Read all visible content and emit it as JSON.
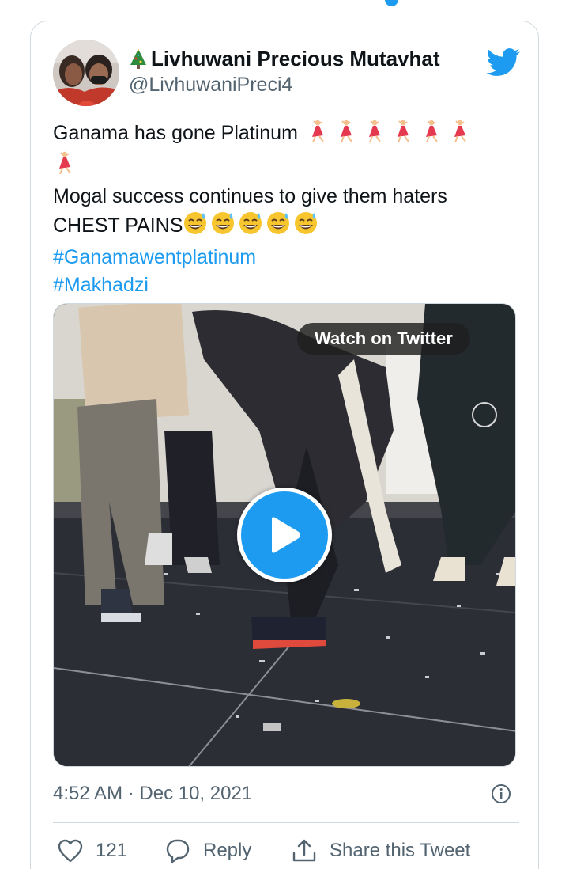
{
  "tweet": {
    "author": {
      "display_name": "Livhuwani Precious Mutavhat",
      "name_prefix_emoji": "🎄",
      "handle": "@LivhuwaniPreci4"
    },
    "text_lines": [
      "Ganama has gone Platinum 💃💃💃💃💃💃",
      "💃",
      "Mogal success continues to give them haters",
      "CHEST PAINS😅😅😅😅😅"
    ],
    "line1_text": "Ganama has gone Platinum",
    "line2_text": "Mogal success continues to give them haters",
    "line3_text": "CHEST PAINS",
    "hashtags": [
      "#Ganamawentplatinum",
      "#Makhadzi"
    ],
    "media": {
      "watch_label": "Watch on Twitter"
    },
    "timestamp": "4:52 AM · Dec 10, 2021",
    "actions": {
      "like_count": "121",
      "reply_label": "Reply",
      "share_label": "Share this Tweet"
    }
  },
  "icons": {
    "bird": "twitter-bird-icon",
    "info": "info-icon",
    "like": "heart-icon",
    "reply": "reply-bubble-icon",
    "share": "share-icon",
    "play": "play-icon",
    "tree": "christmas-tree-icon"
  },
  "colors": {
    "accent": "#1d9bf0",
    "text": "#0f1419",
    "muted": "#536471",
    "border": "#cfd9de"
  }
}
